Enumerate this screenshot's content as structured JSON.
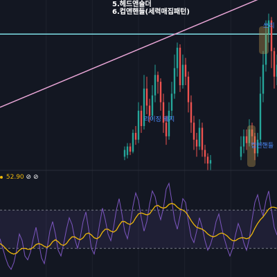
{
  "annotations": {
    "line5": "5.헤드앤숄더",
    "line6": "6.컵앤핸들(세력매집패턴)"
  },
  "labels": {
    "pattern_a": "라이징 웨지",
    "pattern_b": "컵앤핸들",
    "pattern_c": "쓰리"
  },
  "rsi": {
    "value": "52.90",
    "icon_a": "⊘",
    "icon_b": "⊘"
  },
  "colors": {
    "background": "#131722",
    "up": "#26a69a",
    "down": "#ef5350",
    "trendline": "#e8a5d6",
    "horizontal": "#7fe0e8",
    "rsi_line": "#7e57c2",
    "rsi_ma": "#f0b90b"
  },
  "chart_data": [
    {
      "type": "candlestick",
      "x_range": [
        0,
        100
      ],
      "y_range": [
        0,
        100
      ],
      "horizontal_level": 80,
      "trendline": [
        [
          0,
          37
        ],
        [
          100,
          105
        ]
      ],
      "candles": [
        [
          45,
          8,
          12,
          14,
          6
        ],
        [
          46,
          9,
          14,
          16,
          7
        ],
        [
          47,
          14,
          11,
          16,
          9
        ],
        [
          48,
          11,
          22,
          24,
          10
        ],
        [
          49,
          22,
          18,
          26,
          15
        ],
        [
          50,
          18,
          35,
          40,
          16
        ],
        [
          51,
          35,
          26,
          38,
          22
        ],
        [
          52,
          26,
          48,
          56,
          24
        ],
        [
          53,
          48,
          38,
          55,
          33
        ],
        [
          54,
          38,
          32,
          42,
          28
        ],
        [
          55,
          32,
          44,
          50,
          30
        ],
        [
          56,
          44,
          56,
          62,
          40
        ],
        [
          57,
          56,
          52,
          58,
          45
        ],
        [
          58,
          52,
          40,
          54,
          35
        ],
        [
          59,
          40,
          28,
          45,
          22
        ],
        [
          60,
          28,
          20,
          32,
          15
        ],
        [
          61,
          20,
          35,
          40,
          18
        ],
        [
          62,
          35,
          45,
          52,
          30
        ],
        [
          63,
          45,
          60,
          68,
          42
        ],
        [
          64,
          60,
          72,
          75,
          55
        ],
        [
          65,
          72,
          50,
          74,
          46
        ],
        [
          66,
          50,
          62,
          68,
          48
        ],
        [
          67,
          62,
          55,
          66,
          50
        ],
        [
          68,
          55,
          40,
          58,
          34
        ],
        [
          69,
          40,
          28,
          44,
          22
        ],
        [
          70,
          28,
          18,
          32,
          12
        ],
        [
          71,
          18,
          14,
          22,
          8
        ],
        [
          72,
          14,
          25,
          30,
          12
        ],
        [
          73,
          25,
          12,
          28,
          8
        ],
        [
          74,
          12,
          8,
          15,
          4
        ],
        [
          75,
          8,
          4,
          10,
          0
        ],
        [
          76,
          4,
          6,
          9,
          0
        ],
        [
          87,
          8,
          14,
          20,
          6
        ],
        [
          88,
          14,
          20,
          24,
          10
        ],
        [
          89,
          20,
          16,
          24,
          12
        ],
        [
          90,
          16,
          24,
          30,
          14
        ],
        [
          91,
          24,
          20,
          28,
          15
        ],
        [
          92,
          20,
          10,
          22,
          6
        ],
        [
          93,
          10,
          18,
          22,
          8
        ],
        [
          94,
          18,
          45,
          55,
          16
        ],
        [
          95,
          45,
          62,
          70,
          40
        ],
        [
          96,
          62,
          80,
          88,
          58
        ],
        [
          97,
          80,
          88,
          92,
          75
        ],
        [
          98,
          88,
          70,
          90,
          60
        ],
        [
          99,
          70,
          55,
          72,
          48
        ],
        [
          100,
          55,
          62,
          68,
          50
        ]
      ]
    },
    {
      "type": "line",
      "x_range": [
        0,
        100
      ],
      "y_range": [
        0,
        100
      ],
      "series": [
        {
          "values": [
            40,
            30,
            20,
            12,
            8,
            15,
            28,
            45,
            38,
            22,
            18,
            26,
            40,
            52,
            36,
            20,
            14,
            30,
            48,
            58,
            45,
            28,
            22,
            35,
            50,
            62,
            55,
            40,
            30,
            42,
            58,
            68,
            50,
            30,
            24,
            38,
            56,
            72,
            60,
            45,
            38,
            52,
            70,
            82,
            66,
            48,
            40,
            55,
            74,
            88,
            80,
            62,
            48,
            58,
            76,
            90,
            84,
            70,
            60,
            72,
            92,
            98,
            80,
            60,
            50,
            64,
            82,
            78,
            58,
            42,
            36,
            48,
            62,
            52,
            38,
            28,
            34,
            44,
            58,
            66,
            52,
            40,
            30,
            22,
            30,
            44,
            56,
            48,
            36,
            28,
            40,
            60,
            78,
            86,
            72,
            64,
            80,
            90,
            70,
            52,
            44
          ]
        },
        {
          "values": [
            35,
            33,
            30,
            27,
            25,
            24,
            25,
            28,
            30,
            30,
            29,
            29,
            31,
            34,
            35,
            34,
            32,
            31,
            33,
            37,
            39,
            37,
            34,
            33,
            35,
            39,
            42,
            42,
            40,
            39,
            41,
            45,
            46,
            44,
            41,
            40,
            42,
            47,
            50,
            50,
            48,
            47,
            49,
            54,
            58,
            58,
            56,
            55,
            57,
            62,
            66,
            67,
            66,
            65,
            66,
            70,
            74,
            75,
            73,
            72,
            73,
            76,
            77,
            76,
            73,
            71,
            70,
            68,
            64,
            59,
            55,
            52,
            51,
            50,
            48,
            45,
            43,
            42,
            43,
            45,
            46,
            45,
            43,
            40,
            38,
            38,
            40,
            41,
            41,
            40,
            41,
            45,
            51,
            56,
            60,
            63,
            67,
            71,
            73,
            73,
            72
          ]
        }
      ],
      "levels": [
        70,
        30
      ]
    }
  ]
}
